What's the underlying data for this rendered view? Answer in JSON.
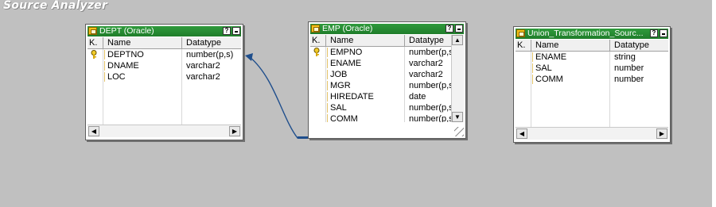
{
  "workspace": {
    "title": "Source Analyzer"
  },
  "windows": {
    "dept": {
      "title": "DEPT (Oracle)",
      "columns": [
        "K.",
        "Name",
        "Datatype"
      ],
      "rows": [
        {
          "key": true,
          "name": "DEPTNO",
          "datatype": "number(p,s)"
        },
        {
          "key": false,
          "name": "DNAME",
          "datatype": "varchar2"
        },
        {
          "key": false,
          "name": "LOC",
          "datatype": "varchar2"
        }
      ]
    },
    "emp": {
      "title": "EMP (Oracle)",
      "columns": [
        "K.",
        "Name",
        "Datatype"
      ],
      "rows": [
        {
          "key": true,
          "name": "EMPNO",
          "datatype": "number(p,s"
        },
        {
          "key": false,
          "name": "ENAME",
          "datatype": "varchar2"
        },
        {
          "key": false,
          "name": "JOB",
          "datatype": "varchar2"
        },
        {
          "key": false,
          "name": "MGR",
          "datatype": "number(p,s"
        },
        {
          "key": false,
          "name": "HIREDATE",
          "datatype": "date"
        },
        {
          "key": false,
          "name": "SAL",
          "datatype": "number(p,s"
        },
        {
          "key": false,
          "name": "COMM",
          "datatype": "number(p,s"
        }
      ]
    },
    "union": {
      "title": "Union_Transformation_Sourc...",
      "columns": [
        "K.",
        "Name",
        "Datatype"
      ],
      "rows": [
        {
          "key": false,
          "name": "ENAME",
          "datatype": "string"
        },
        {
          "key": false,
          "name": "SAL",
          "datatype": "number"
        },
        {
          "key": false,
          "name": "COMM",
          "datatype": "number"
        }
      ]
    }
  },
  "buttons": {
    "help": "?",
    "scroll_left": "◀",
    "scroll_right": "▶",
    "scroll_up": "▲",
    "scroll_down": "▼"
  },
  "icons": {
    "window": "table-icon",
    "key": "key-icon",
    "link": "link-arrow"
  },
  "colors": {
    "titlebar": "#1f8a2c",
    "canvas": "#c0c0c0",
    "link": "#1f4e8c"
  }
}
